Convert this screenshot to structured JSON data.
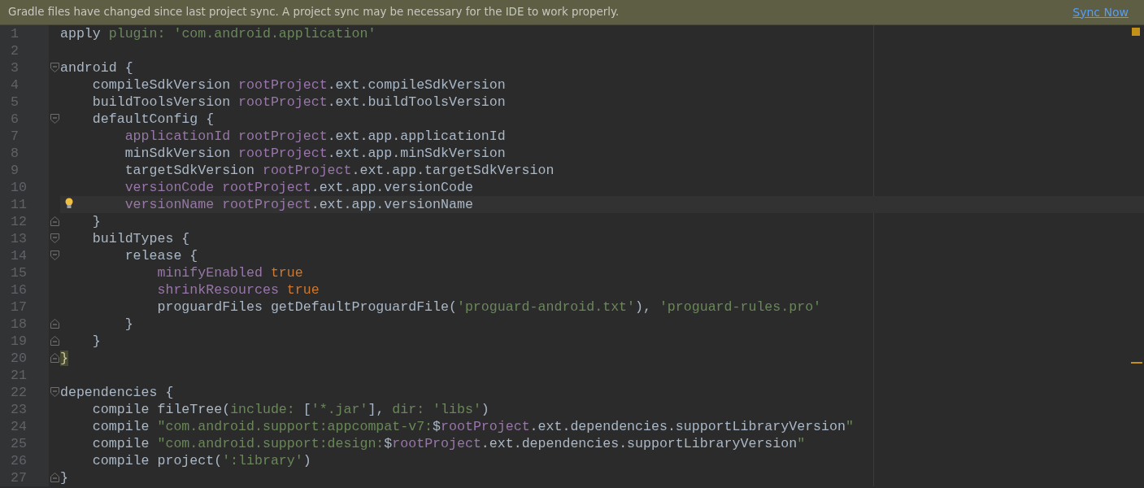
{
  "banner": {
    "message": "Gradle files have changed since last project sync. A project sync may be necessary for the IDE to work properly.",
    "action": "Sync Now"
  },
  "lines": [
    {
      "number": "1",
      "tokens": [
        {
          "text": "apply ",
          "kind": "plain"
        },
        {
          "text": "plugin: ",
          "kind": "label"
        },
        {
          "text": "'com.android.application'",
          "kind": "string"
        }
      ]
    },
    {
      "number": "2"
    },
    {
      "number": "3",
      "fold_start": true,
      "tokens": [
        {
          "text": "android {",
          "kind": "plain"
        }
      ]
    },
    {
      "number": "4",
      "tokens": [
        {
          "text": "    compileSdkVersion ",
          "kind": "plain"
        },
        {
          "text": "rootProject",
          "kind": "property"
        },
        {
          "text": ".ext.compileSdkVersion",
          "kind": "plain"
        }
      ]
    },
    {
      "number": "5",
      "tokens": [
        {
          "text": "    buildToolsVersion ",
          "kind": "plain"
        },
        {
          "text": "rootProject",
          "kind": "property"
        },
        {
          "text": ".ext.buildToolsVersion",
          "kind": "plain"
        }
      ]
    },
    {
      "number": "6",
      "fold_start": true,
      "tokens": [
        {
          "text": "    defaultConfig {",
          "kind": "plain"
        }
      ]
    },
    {
      "number": "7",
      "tokens": [
        {
          "text": "        applicationId ",
          "kind": "property"
        },
        {
          "text": "rootProject",
          "kind": "property"
        },
        {
          "text": ".ext.app.applicationId",
          "kind": "plain"
        }
      ]
    },
    {
      "number": "8",
      "tokens": [
        {
          "text": "        minSdkVersion ",
          "kind": "plain"
        },
        {
          "text": "rootProject",
          "kind": "property"
        },
        {
          "text": ".ext.app.minSdkVersion",
          "kind": "plain"
        }
      ]
    },
    {
      "number": "9",
      "tokens": [
        {
          "text": "        targetSdkVersion ",
          "kind": "plain"
        },
        {
          "text": "rootProject",
          "kind": "property"
        },
        {
          "text": ".ext.app.targetSdkVersion",
          "kind": "plain"
        }
      ]
    },
    {
      "number": "10",
      "tokens": [
        {
          "text": "        versionCode ",
          "kind": "property"
        },
        {
          "text": "rootProject",
          "kind": "property"
        },
        {
          "text": ".ext.app.versionCode",
          "kind": "plain"
        }
      ]
    },
    {
      "number": "11",
      "current": true,
      "bulb": true,
      "tokens": [
        {
          "text": "        versionName ",
          "kind": "property"
        },
        {
          "text": "rootProject",
          "kind": "property"
        },
        {
          "text": ".ext.app.versionName",
          "kind": "plain"
        }
      ]
    },
    {
      "number": "12",
      "fold_end": true,
      "tokens": [
        {
          "text": "    }",
          "kind": "plain"
        }
      ]
    },
    {
      "number": "13",
      "fold_start": true,
      "tokens": [
        {
          "text": "    buildTypes {",
          "kind": "plain"
        }
      ]
    },
    {
      "number": "14",
      "fold_start": true,
      "tokens": [
        {
          "text": "        release {",
          "kind": "plain"
        }
      ]
    },
    {
      "number": "15",
      "tokens": [
        {
          "text": "            minifyEnabled ",
          "kind": "property"
        },
        {
          "text": "true",
          "kind": "keyword"
        }
      ]
    },
    {
      "number": "16",
      "tokens": [
        {
          "text": "            shrinkResources ",
          "kind": "property"
        },
        {
          "text": "true",
          "kind": "keyword"
        }
      ]
    },
    {
      "number": "17",
      "tokens": [
        {
          "text": "            proguardFiles getDefaultProguardFile(",
          "kind": "plain"
        },
        {
          "text": "'proguard-android.txt'",
          "kind": "string"
        },
        {
          "text": "), ",
          "kind": "plain"
        },
        {
          "text": "'proguard-rules.pro'",
          "kind": "string"
        }
      ]
    },
    {
      "number": "18",
      "fold_end": true,
      "tokens": [
        {
          "text": "        }",
          "kind": "plain"
        }
      ]
    },
    {
      "number": "19",
      "fold_end": true,
      "tokens": [
        {
          "text": "    }",
          "kind": "plain"
        }
      ]
    },
    {
      "number": "20",
      "fold_end": true,
      "tokens": [
        {
          "text": "}",
          "kind": "brace-match"
        }
      ]
    },
    {
      "number": "21"
    },
    {
      "number": "22",
      "fold_start": true,
      "tokens": [
        {
          "text": "dependencies {",
          "kind": "plain"
        }
      ]
    },
    {
      "number": "23",
      "tokens": [
        {
          "text": "    compile fileTree(",
          "kind": "plain"
        },
        {
          "text": "include: ",
          "kind": "label"
        },
        {
          "text": "[",
          "kind": "plain"
        },
        {
          "text": "'*.jar'",
          "kind": "string"
        },
        {
          "text": "], ",
          "kind": "plain"
        },
        {
          "text": "dir: ",
          "kind": "label"
        },
        {
          "text": "'libs'",
          "kind": "string"
        },
        {
          "text": ")",
          "kind": "plain"
        }
      ]
    },
    {
      "number": "24",
      "tokens": [
        {
          "text": "    compile ",
          "kind": "plain"
        },
        {
          "text": "\"com.android.support:appcompat-v7:",
          "kind": "string"
        },
        {
          "text": "$",
          "kind": "plain"
        },
        {
          "text": "rootProject",
          "kind": "property"
        },
        {
          "text": ".ext.dependencies.supportLibraryVersion",
          "kind": "plain"
        },
        {
          "text": "\"",
          "kind": "string"
        }
      ]
    },
    {
      "number": "25",
      "tokens": [
        {
          "text": "    compile ",
          "kind": "plain"
        },
        {
          "text": "\"com.android.support:design:",
          "kind": "string"
        },
        {
          "text": "$",
          "kind": "plain"
        },
        {
          "text": "rootProject",
          "kind": "property"
        },
        {
          "text": ".ext.dependencies.supportLibraryVersion",
          "kind": "plain"
        },
        {
          "text": "\"",
          "kind": "string"
        }
      ]
    },
    {
      "number": "26",
      "tokens": [
        {
          "text": "    compile project(",
          "kind": "plain"
        },
        {
          "text": "':library'",
          "kind": "string"
        },
        {
          "text": ")",
          "kind": "plain"
        }
      ]
    },
    {
      "number": "27",
      "fold_end": true,
      "tokens": [
        {
          "text": "}",
          "kind": "plain"
        }
      ]
    }
  ]
}
